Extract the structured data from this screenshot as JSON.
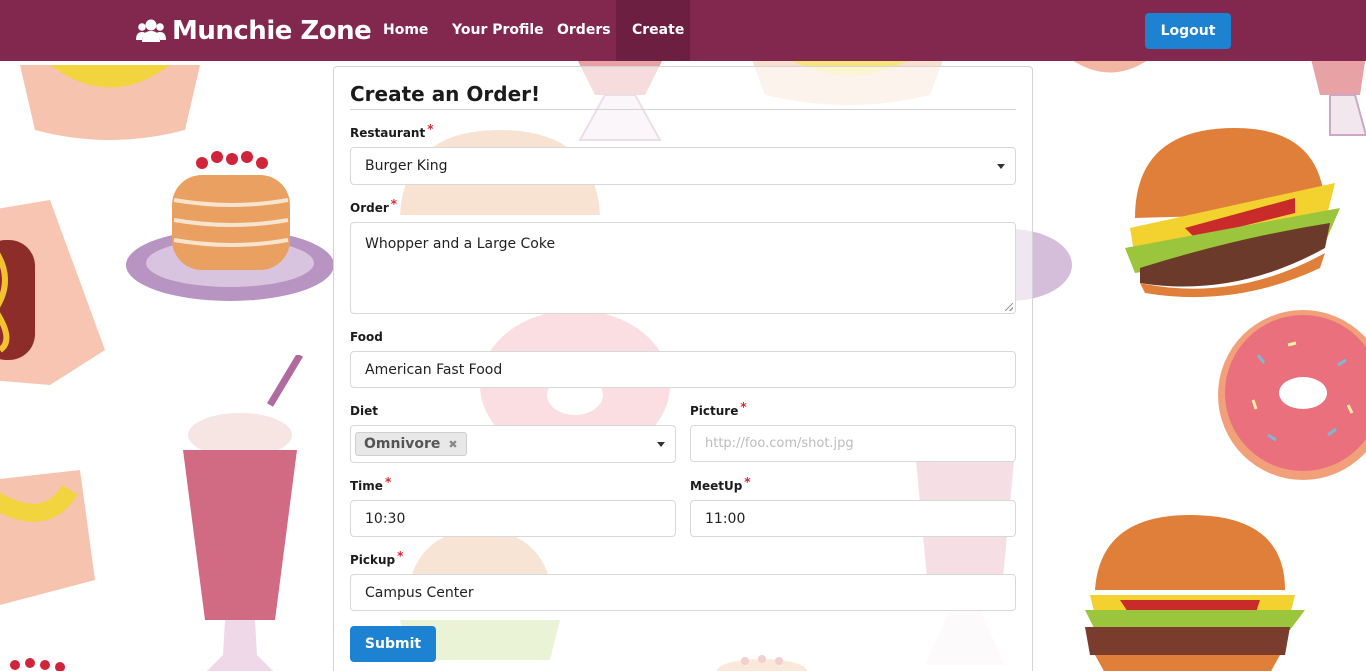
{
  "app": {
    "brand": "Munchie Zone"
  },
  "nav": {
    "items": [
      {
        "label": "Home"
      },
      {
        "label": "Your Profile"
      },
      {
        "label": "Orders"
      },
      {
        "label": "Create"
      }
    ],
    "active": "Create",
    "logout_label": "Logout"
  },
  "form": {
    "title": "Create an Order!",
    "restaurant": {
      "label": "Restaurant",
      "required": true,
      "value": "Burger King"
    },
    "order": {
      "label": "Order",
      "required": true,
      "value": "Whopper and a Large Coke"
    },
    "food": {
      "label": "Food",
      "required": false,
      "value": "American Fast Food"
    },
    "diet": {
      "label": "Diet",
      "required": false,
      "selected": "Omnivore"
    },
    "picture": {
      "label": "Picture",
      "required": true,
      "value": "",
      "placeholder": "http://foo.com/shot.jpg"
    },
    "time": {
      "label": "Time",
      "required": true,
      "value": "10:30"
    },
    "meetup": {
      "label": "MeetUp",
      "required": true,
      "value": "11:00"
    },
    "pickup": {
      "label": "Pickup",
      "required": true,
      "value": "Campus Center"
    },
    "submit_label": "Submit",
    "required_marker": "*"
  },
  "colors": {
    "navbar": "#82284f",
    "navbar_active": "#6d1f41",
    "primary_button": "#1e82d3",
    "required": "#db2828"
  },
  "icons": {
    "brand": "users-icon",
    "dropdown": "caret-down-icon",
    "remove": "close-icon"
  }
}
